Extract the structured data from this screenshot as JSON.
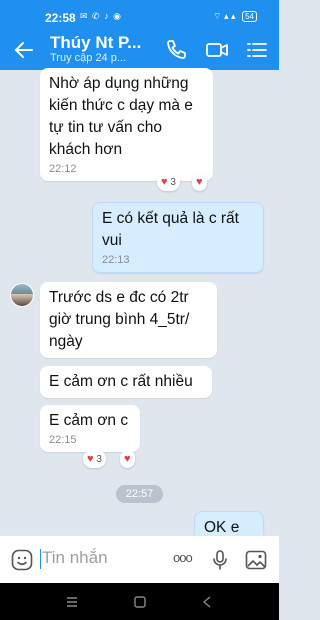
{
  "status": {
    "time": "22:58",
    "icons": "✉ ✆ ♪ ◉",
    "signal": "⌔ ▴ ▴",
    "battery": "54"
  },
  "header": {
    "title": "Thúy Nt P...",
    "subtitle": "Truy cập 24 p..."
  },
  "messages": [
    {
      "text": "Nhờ áp dụng những kiến thức c dạy mà e tự tin tư vấn cho khách hơn",
      "time": "22:12",
      "reaction_count": "3"
    },
    {
      "text": "E có kết quả là c rất vui",
      "time": "22:13"
    },
    {
      "text": "Trước ds e đc có 2tr giờ trung bình 4_5tr/ ngày"
    },
    {
      "text": "E cảm ơn c rất nhiều"
    },
    {
      "text": "E cảm ơn c",
      "time": "22:15",
      "reaction_count": "3"
    },
    {
      "text": "OK e"
    }
  ],
  "time_separator": "22:57",
  "input": {
    "placeholder": "Tin nhắn",
    "more": "ooo"
  },
  "colors": {
    "accent": "#1f8ff0",
    "outgoing_bubble": "#d6ecff",
    "heart": "#e43c48"
  },
  "icons": [
    "back-arrow-icon",
    "phone-icon",
    "video-icon",
    "menu-icon",
    "emoji-icon",
    "microphone-icon",
    "image-icon"
  ]
}
